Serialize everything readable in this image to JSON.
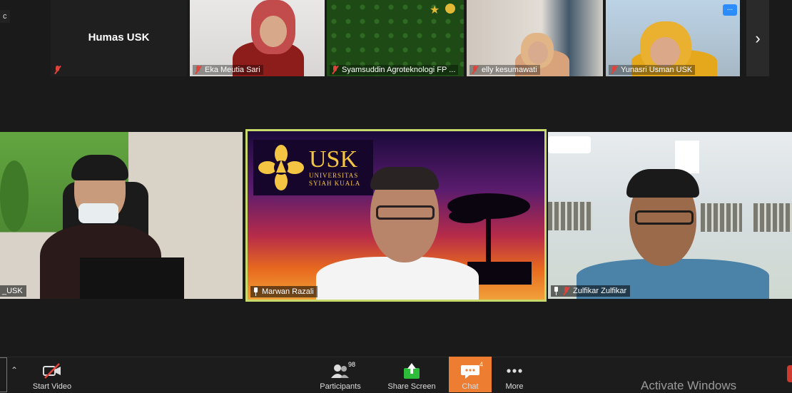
{
  "top_strip": {
    "edge_label": "c",
    "participants": [
      {
        "name": "Humas USK",
        "mic_muted": true
      },
      {
        "name": "Eka Meutia Sari",
        "mic_muted": true
      },
      {
        "name": "Syamsuddin Agroteknologi FP ...",
        "mic_muted": true
      },
      {
        "name": "elly kesumawati",
        "mic_muted": true
      },
      {
        "name": "Yunasri Usman USK",
        "mic_muted": true
      }
    ],
    "more_options_label": "...",
    "next_page_label": "›"
  },
  "gallery": {
    "left": {
      "name": "_USK",
      "mic_muted": false
    },
    "center": {
      "name": "Marwan Razali",
      "pinned": true,
      "active_speaker": true,
      "logo_big": "USK",
      "logo_line1": "UNIVERSITAS",
      "logo_line2": "SYIAH KUALA"
    },
    "right": {
      "name": "Zulfikar Zulfikar",
      "mic_muted": true
    }
  },
  "toolbar": {
    "start_video": "Start Video",
    "participants": "Participants",
    "participants_count": "98",
    "share_screen": "Share Screen",
    "chat": "Chat",
    "chat_badge": "4",
    "more": "More"
  },
  "watermark": "Activate Windows",
  "colors": {
    "active_speaker_border": "#c7d96a",
    "chat_active": "#ed7d31",
    "muted_red": "#e0433b",
    "share_green": "#2dbd3a"
  }
}
